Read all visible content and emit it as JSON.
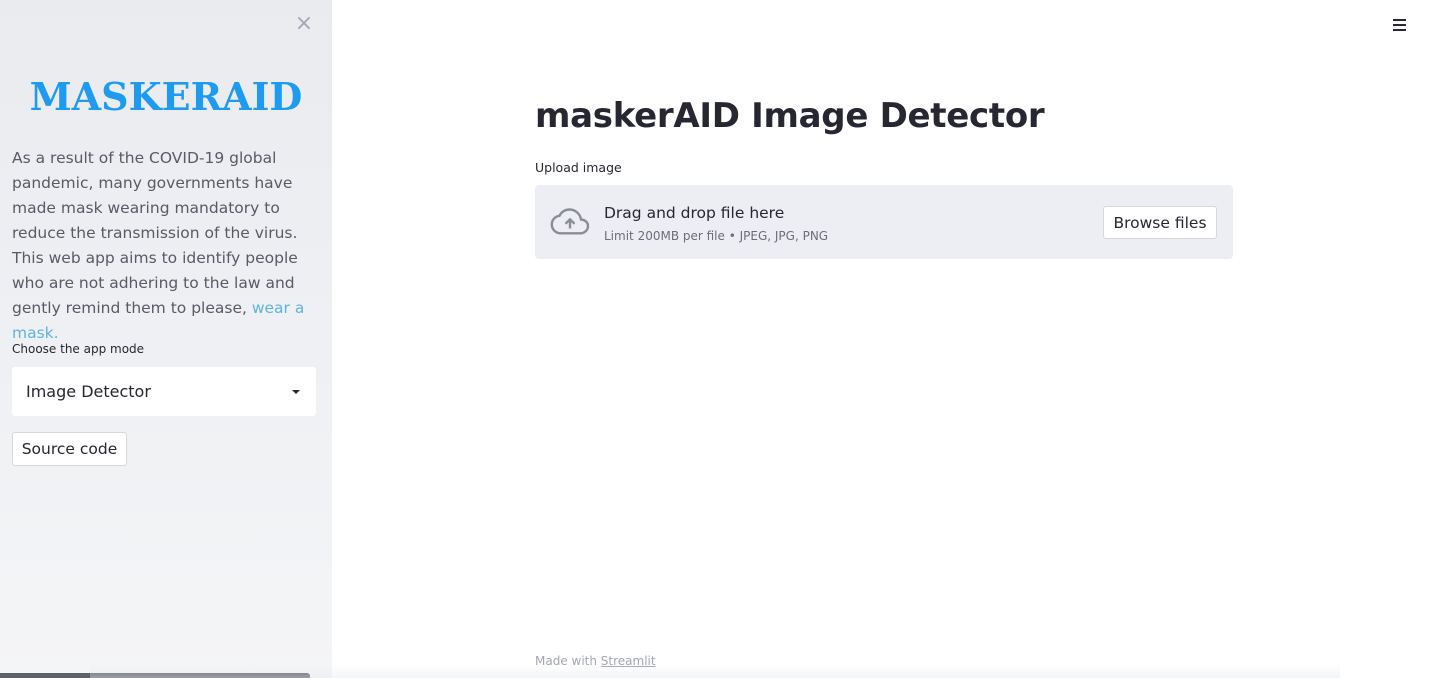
{
  "sidebar": {
    "close_symbol": "×",
    "brand": "MASKERAID",
    "about_text": "As a result of the COVID-19 global pandemic, many governments have made mask wearing mandatory to reduce the transmission of the virus. This web app aims to identify people who are not adhering to the law and gently remind them to please, ",
    "about_link": "wear a mask.",
    "mode_label": "Choose the app mode",
    "mode_selected": "Image Detector",
    "source_button": "Source code"
  },
  "main": {
    "title": "maskerAID Image Detector",
    "upload_label": "Upload image",
    "dropzone": {
      "title": "Drag and drop file here",
      "subtitle": "Limit 200MB per file • JPEG, JPG, PNG",
      "browse_label": "Browse files",
      "icon": "cloud-upload-icon"
    }
  },
  "footer": {
    "prefix": "Made with ",
    "link": "Streamlit"
  },
  "colors": {
    "brand": "#1e9bf0",
    "link": "#5fb3e0",
    "sidebar_bg": "#eef0f3",
    "dropzone_bg": "#eceef3"
  }
}
